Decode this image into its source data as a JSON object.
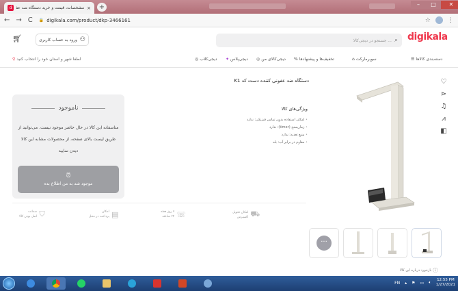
{
  "browser": {
    "tab_title": "مشخصات، قیمت و خرید دستگاه ضد عفو...",
    "tab_close": "×",
    "new_tab": "+",
    "url": "digikala.com/product/dkp-3466161",
    "nav_back": "←",
    "nav_forward": "→",
    "nav_reload": "C"
  },
  "header": {
    "logo": "digikala",
    "search_placeholder": "جستجو در دیجی‌کالا ...",
    "login_label": "ورود به حساب کاربری"
  },
  "nav": {
    "categories": "دسته‌بندی کالاها",
    "supermarket": "سوپرمارکت",
    "discounts": "تخفیف‌ها و پیشنهادها",
    "my_digikala": "دیجی‌کالای من",
    "digiplus": "دیجی‌پلاس",
    "digiclub": "دیجی‌کلاب",
    "location": "لطفا شهر و استان خود را انتخاب کنید"
  },
  "product": {
    "title": "دستگاه ضد عفونی کننده دست کد K1",
    "features_title": "ویژگی‌های کالا",
    "features": [
      "امکان استفاده بدون تماس فیزیکی: ندارد",
      "زمان‌سنج (timer): ندارد",
      "منبع تغذیه: ندارد",
      "مقاوم در برابر آب: بله"
    ],
    "report": "بازخورد درباره این کالا"
  },
  "stock": {
    "status": "ناموجود",
    "message": "متاسفانه این کالا در حال حاضر موجود نیست. می‌توانید از طریق لیست بالای صفحه، از محصولات مشابه این کالا دیدن نمایید",
    "notify_button": "موجود شد به من اطلاع بده"
  },
  "badges": [
    {
      "title": "امکان تحویل",
      "sub": "اکسپرس"
    },
    {
      "title": "۷ روز هفته",
      "sub": "۲۴ ساعته"
    },
    {
      "title": "امکان",
      "sub": "پرداخت در محل"
    },
    {
      "title": "ضمانت",
      "sub": "اصل بودن کالا"
    }
  ],
  "more_thumbs": "···",
  "taskbar": {
    "lang": "FN",
    "time": "12:55 PM",
    "date": "1/27/2021"
  },
  "colors": {
    "brand": "#ef394e",
    "notify_button": "#9e9fa3",
    "stock_box": "#f0f0f1",
    "taskbar": "#1d3f73"
  }
}
